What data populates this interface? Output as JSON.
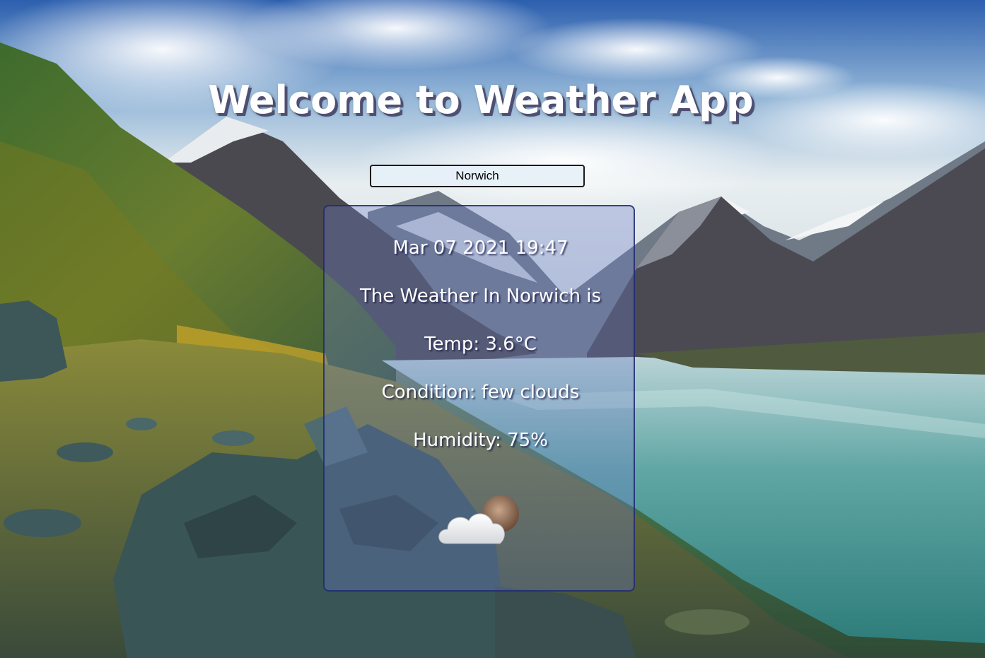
{
  "app": {
    "title": "Welcome to Weather App"
  },
  "search": {
    "value": "Norwich"
  },
  "weather": {
    "datetime": "Mar 07 2021 19:47",
    "heading": "The Weather In Norwich is",
    "temp": "Temp: 3.6°C",
    "condition": "Condition: few clouds",
    "humidity": "Humidity: 75%",
    "icon": "few-clouds-night-icon"
  },
  "colors": {
    "title_shadow": "#4d4f73",
    "card_border": "#1e286e",
    "text": "#ffffff"
  }
}
